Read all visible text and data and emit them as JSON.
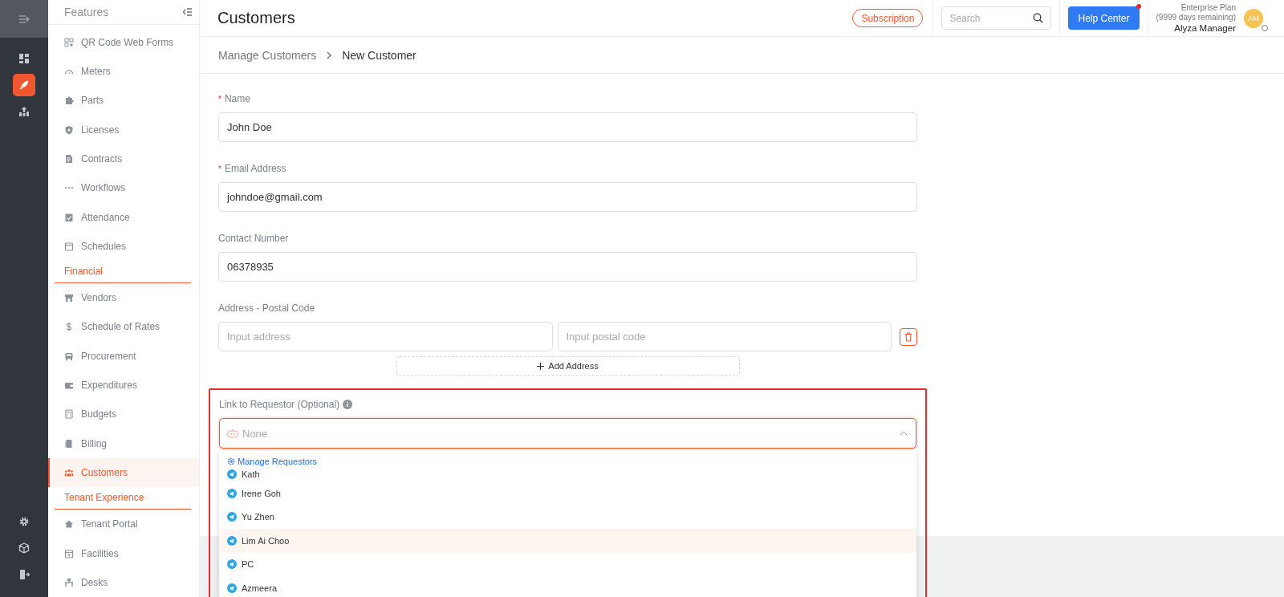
{
  "rail": [
    {
      "selected": false
    },
    {
      "selected": true
    },
    {
      "selected": false
    }
  ],
  "rail_bottom": [
    {
      "selected": false
    },
    {
      "selected": false
    },
    {
      "selected": false
    }
  ],
  "sidebar": {
    "title": "Features",
    "items": [
      {
        "kind": "item",
        "label": "QR Code Web Forms",
        "selected": false
      },
      {
        "kind": "item",
        "label": "Meters",
        "selected": false
      },
      {
        "kind": "item",
        "label": "Parts",
        "selected": false
      },
      {
        "kind": "item",
        "label": "Licenses",
        "selected": false
      },
      {
        "kind": "item",
        "label": "Contracts",
        "selected": false
      },
      {
        "kind": "item",
        "label": "Workflows",
        "selected": false
      },
      {
        "kind": "item",
        "label": "Attendance",
        "selected": false
      },
      {
        "kind": "item",
        "label": "Schedules",
        "selected": false
      },
      {
        "kind": "section",
        "label": "Financial"
      },
      {
        "kind": "item",
        "label": "Vendors",
        "selected": false
      },
      {
        "kind": "item",
        "label": "Schedule of Rates",
        "selected": false
      },
      {
        "kind": "item",
        "label": "Procurement",
        "selected": false
      },
      {
        "kind": "item",
        "label": "Expenditures",
        "selected": false
      },
      {
        "kind": "item",
        "label": "Budgets",
        "selected": false
      },
      {
        "kind": "item",
        "label": "Billing",
        "selected": false
      },
      {
        "kind": "item",
        "label": "Customers",
        "selected": true
      },
      {
        "kind": "section",
        "label": "Tenant Experience"
      },
      {
        "kind": "item",
        "label": "Tenant Portal",
        "selected": false
      },
      {
        "kind": "item",
        "label": "Facilities",
        "selected": false
      },
      {
        "kind": "item",
        "label": "Desks",
        "selected": false
      }
    ]
  },
  "header": {
    "title": "Customers",
    "subscription": "Subscription",
    "search": {
      "placeholder": "Search"
    },
    "help": {
      "label": "Help Center",
      "notification": true
    },
    "plan": "Enterprise Plan",
    "days": "(9999 days remaining)",
    "user": "Alyza Manager",
    "avatar": "AM"
  },
  "breadcrumb": [
    {
      "label": "Manage Customers",
      "current": false
    },
    {
      "label": "New Customer",
      "current": true
    }
  ],
  "form": {
    "required_mark": "*",
    "fields": [
      {
        "label": "Name",
        "required": true,
        "value": "John Doe"
      },
      {
        "label": "Email Address",
        "required": true,
        "value": "johndoe@gmail.com"
      },
      {
        "label": "Contact Number",
        "required": false,
        "value": "06378935"
      }
    ],
    "address": {
      "label": "Address - Postal Code",
      "address": {
        "placeholder": "Input address"
      },
      "postal": {
        "placeholder": "Input postal code"
      },
      "add": "Add Address"
    },
    "requestor": {
      "label": "Link to Requestor (Optional)",
      "placeholder": "None",
      "expanded": true,
      "manage": "Manage Requestors",
      "options": [
        {
          "label": "Kath",
          "selected": false
        },
        {
          "label": "Irene Goh",
          "selected": false
        },
        {
          "label": "Yu Zhen",
          "selected": false
        },
        {
          "label": "Lim Ai Choo",
          "selected": true
        },
        {
          "label": "PC",
          "selected": false
        },
        {
          "label": "Azmeera",
          "selected": false
        }
      ]
    }
  }
}
